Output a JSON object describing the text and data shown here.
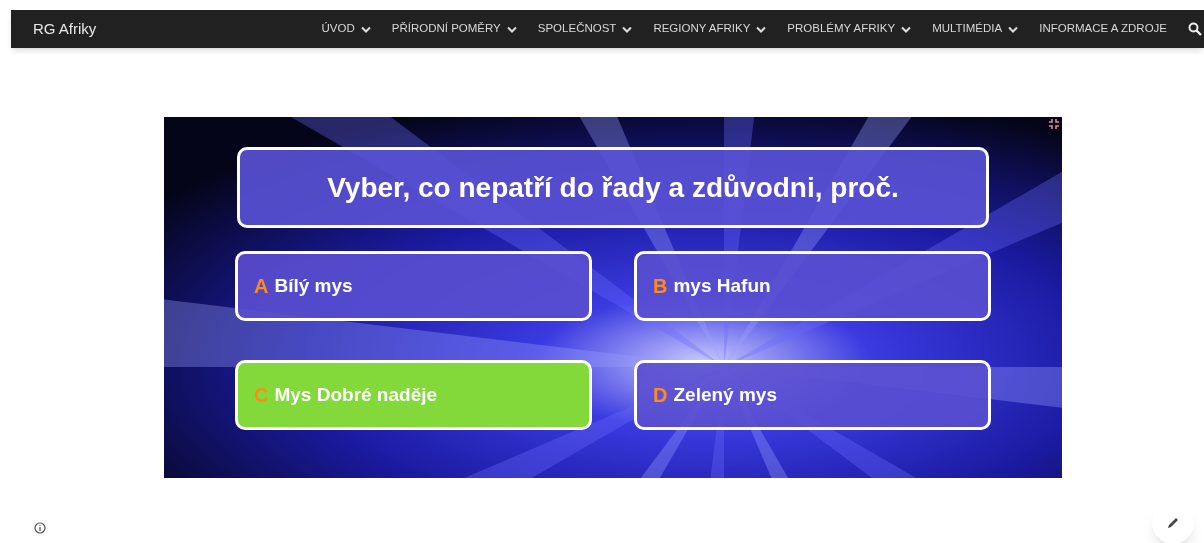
{
  "site_title": "RG Afriky",
  "nav": [
    {
      "label": "ÚVOD",
      "has_menu": true
    },
    {
      "label": "PŘÍRODNÍ POMĚRY",
      "has_menu": true
    },
    {
      "label": "SPOLEČNOST",
      "has_menu": true
    },
    {
      "label": "REGIONY AFRIKY",
      "has_menu": true
    },
    {
      "label": "PROBLÉMY AFRIKY",
      "has_menu": true
    },
    {
      "label": "MULTIMÉDIA",
      "has_menu": true
    },
    {
      "label": "INFORMACE A ZDROJE",
      "has_menu": false
    }
  ],
  "quiz": {
    "question": "Vyber, co nepatří do řady a zdůvodni, proč.",
    "answers": [
      {
        "letter": "A",
        "text": "Bílý mys",
        "selected": false
      },
      {
        "letter": "B",
        "text": "mys Hafun",
        "selected": false
      },
      {
        "letter": "C",
        "text": "Mys Dobré naděje",
        "selected": true
      },
      {
        "letter": "D",
        "text": "Zelený mys",
        "selected": false
      }
    ]
  }
}
